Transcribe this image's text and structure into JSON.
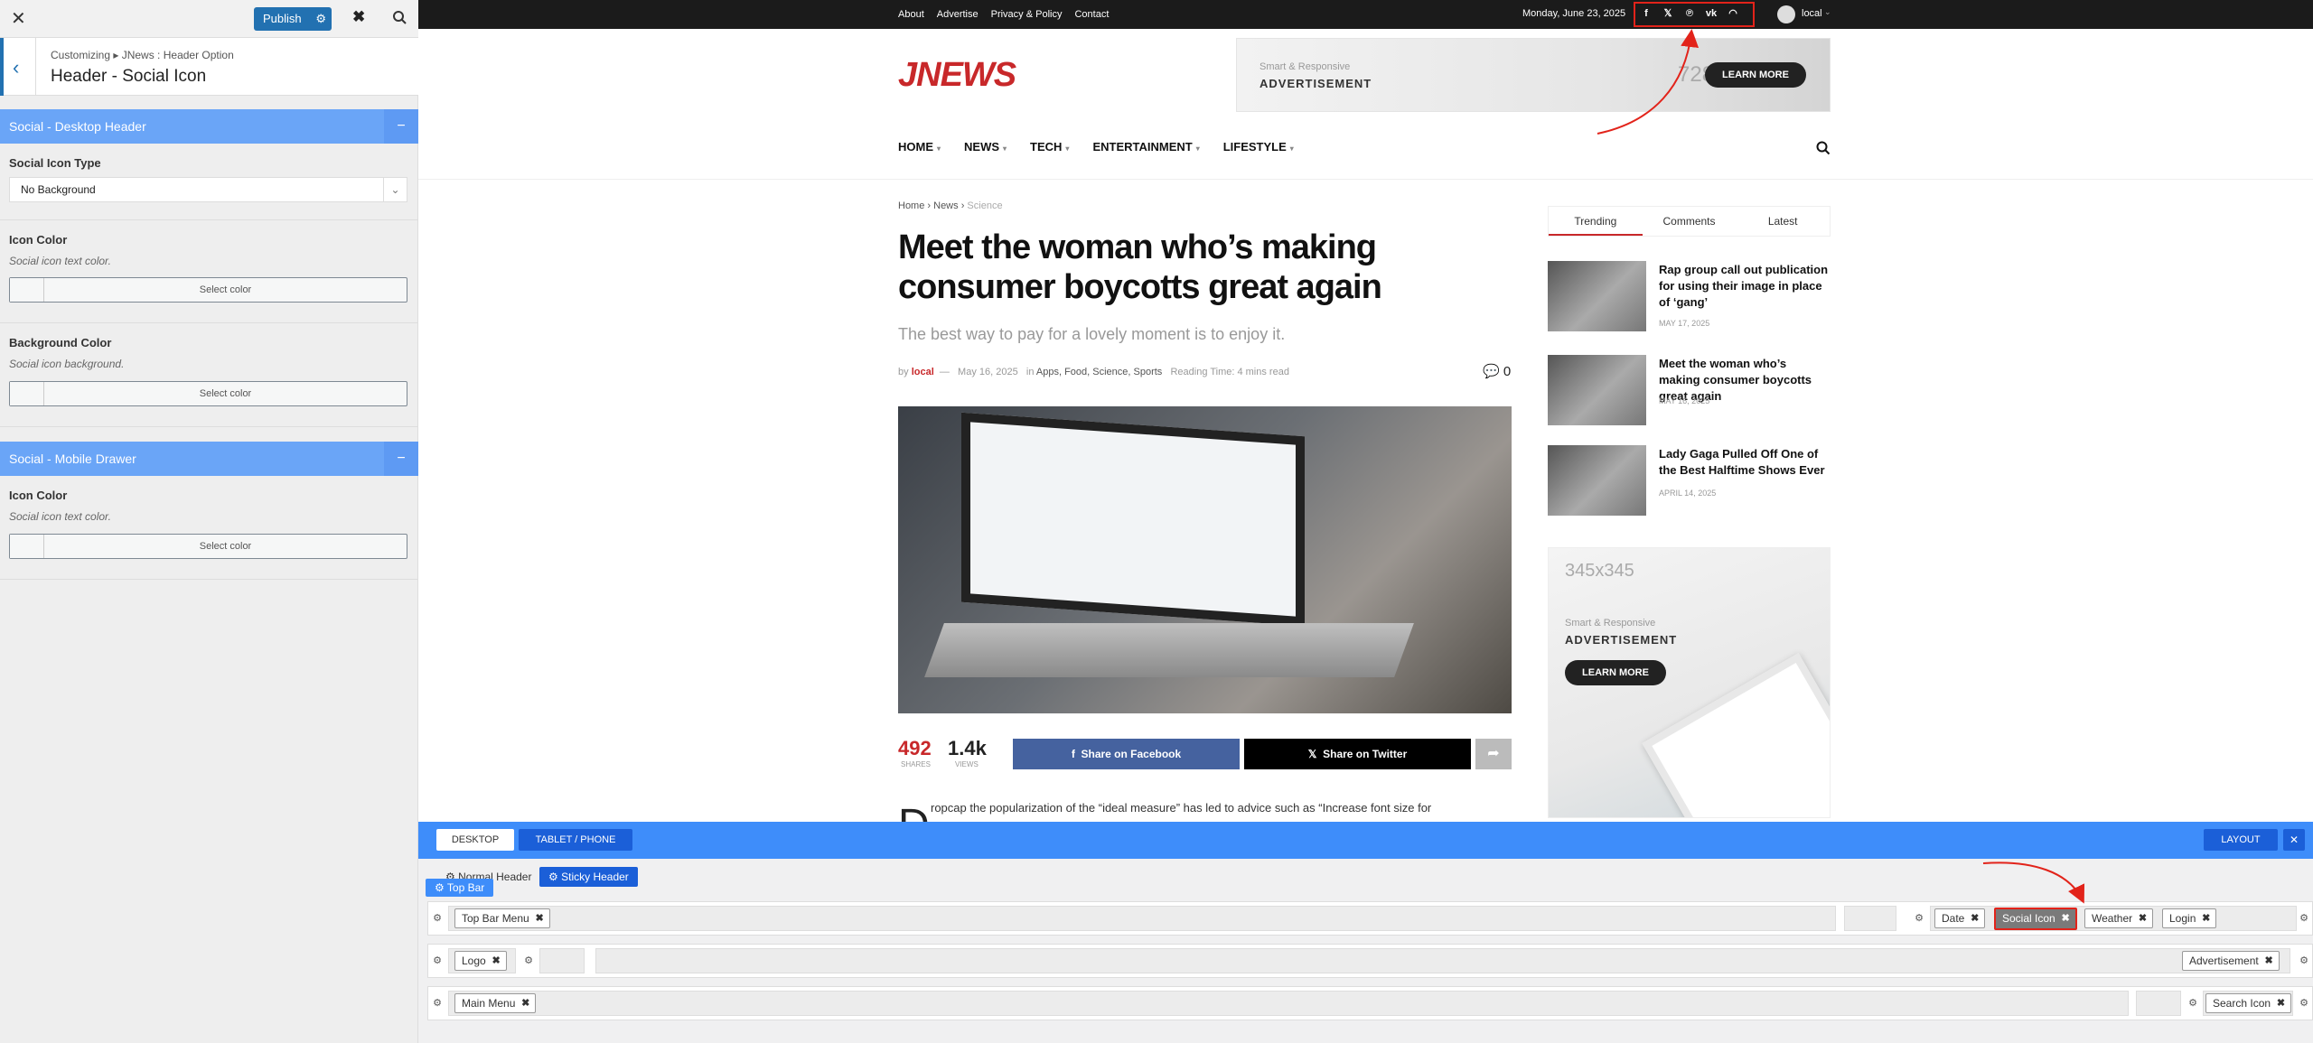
{
  "customizer": {
    "publish_label": "Publish",
    "breadcrumb": "Customizing ▸ JNews : Header Option",
    "title": "Header - Social Icon",
    "sections": [
      {
        "title": "Social - Desktop Header",
        "controls": [
          {
            "label": "Social Icon Type",
            "type": "select",
            "value": "No Background"
          },
          {
            "label": "Icon Color",
            "desc": "Social icon text color.",
            "button": "Select color"
          },
          {
            "label": "Background Color",
            "desc": "Social icon background.",
            "button": "Select color"
          }
        ]
      },
      {
        "title": "Social - Mobile Drawer",
        "controls": [
          {
            "label": "Icon Color",
            "desc": "Social icon text color.",
            "button": "Select color"
          }
        ]
      }
    ]
  },
  "site": {
    "topbar_menu": [
      "About",
      "Advertise",
      "Privacy & Policy",
      "Contact"
    ],
    "date": "Monday, June 23, 2025",
    "social_icons": [
      "facebook-icon",
      "x-icon",
      "pinterest-icon",
      "vk-icon",
      "rss-icon"
    ],
    "user": "local",
    "logo": "JNEWS",
    "ad_top": {
      "line1": "Smart & Responsive",
      "line2": "ADVERTISEMENT",
      "size": "728x90",
      "button": "LEARN MORE"
    },
    "main_menu": [
      "HOME",
      "NEWS",
      "TECH",
      "ENTERTAINMENT",
      "LIFESTYLE"
    ],
    "breadcrumb": {
      "home": "Home",
      "section": "News",
      "current": "Science"
    },
    "article": {
      "title": "Meet the woman who’s making consumer boycotts great again",
      "subtitle": "The best way to pay for a lovely moment is to enjoy it.",
      "by": "by",
      "author": "local",
      "date": "May 16, 2025",
      "in": "in",
      "categories": "Apps, Food, Science, Sports",
      "reading_time": "Reading Time: 4 mins read",
      "comments": "0",
      "shares": "492",
      "shares_label": "SHARES",
      "views": "1.4k",
      "views_label": "VIEWS",
      "share_facebook": "Share on Facebook",
      "share_twitter": "Share on Twitter",
      "dropcap": "D",
      "body_start": "ropcap the popularization of the “ideal measure” has led to advice such as “Increase font size for"
    },
    "sidebar_tabs": [
      "Trending",
      "Comments",
      "Latest"
    ],
    "trending": [
      {
        "title": "Rap group call out publication for using their image in place of ‘gang’",
        "date": "MAY 17, 2025"
      },
      {
        "title": "Meet the woman who’s making consumer boycotts great again",
        "date": "MAY 16, 2025"
      },
      {
        "title": "Lady Gaga Pulled Off One of the Best Halftime Shows Ever",
        "date": "APRIL 14, 2025"
      }
    ],
    "ad_side": {
      "size": "345x345",
      "line1": "Smart & Responsive",
      "line2": "ADVERTISEMENT",
      "button": "LEARN MORE"
    }
  },
  "builder": {
    "device_tabs": [
      "DESKTOP",
      "TABLET / PHONE"
    ],
    "layout_label": "LAYOUT",
    "header_tabs": [
      "Normal Header",
      "Sticky Header"
    ],
    "top_bar_label": "Top Bar",
    "rows": {
      "top": {
        "left": [
          "Top Bar Menu"
        ],
        "right": [
          "Date",
          "Social Icon",
          "Weather",
          "Login"
        ]
      },
      "mid": {
        "left": [
          "Logo"
        ],
        "right": [
          "Advertisement"
        ]
      },
      "bottom": {
        "left": [
          "Main Menu"
        ],
        "right": [
          "Search Icon"
        ]
      }
    }
  },
  "colors": {
    "accent_blue": "#3e8dfa",
    "section_blue": "#6aa5f7",
    "brand_red": "#c8282a",
    "highlight_red": "#e2231a"
  }
}
